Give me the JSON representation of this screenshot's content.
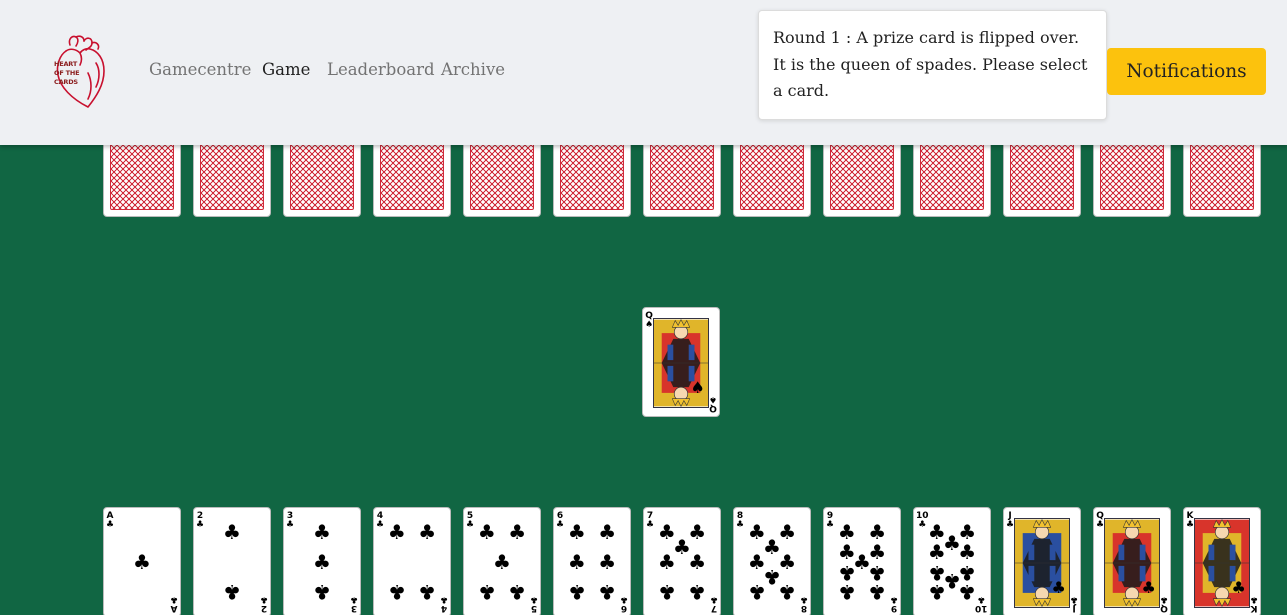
{
  "brand": {
    "logo_text": [
      "HEART",
      "OF THE",
      "CARDS"
    ]
  },
  "nav": {
    "links": [
      {
        "label": "Gamecentre",
        "active": false
      },
      {
        "label": "Game",
        "active": true
      },
      {
        "label": "Leaderboard",
        "active": false
      },
      {
        "label": "Archive",
        "active": false
      }
    ]
  },
  "notification": {
    "message": "Round 1 : A prize card is flipped over. It is the queen of spades. Please select a card.",
    "button_label": "Notifications"
  },
  "game": {
    "opponent_hand": {
      "count": 13,
      "face": "down"
    },
    "prize_card": {
      "rank": "Q",
      "suit": "♠"
    },
    "player_hand": {
      "suit": "♣",
      "ranks": [
        "A",
        "2",
        "3",
        "4",
        "5",
        "6",
        "7",
        "8",
        "9",
        "10",
        "J",
        "Q",
        "K"
      ]
    }
  },
  "colors": {
    "table_felt": "#116643",
    "header_bg": "#eef0f3",
    "notification_button": "#fcc20d",
    "card_back_red": "#d02a3a",
    "logo_red": "#c8102e"
  }
}
